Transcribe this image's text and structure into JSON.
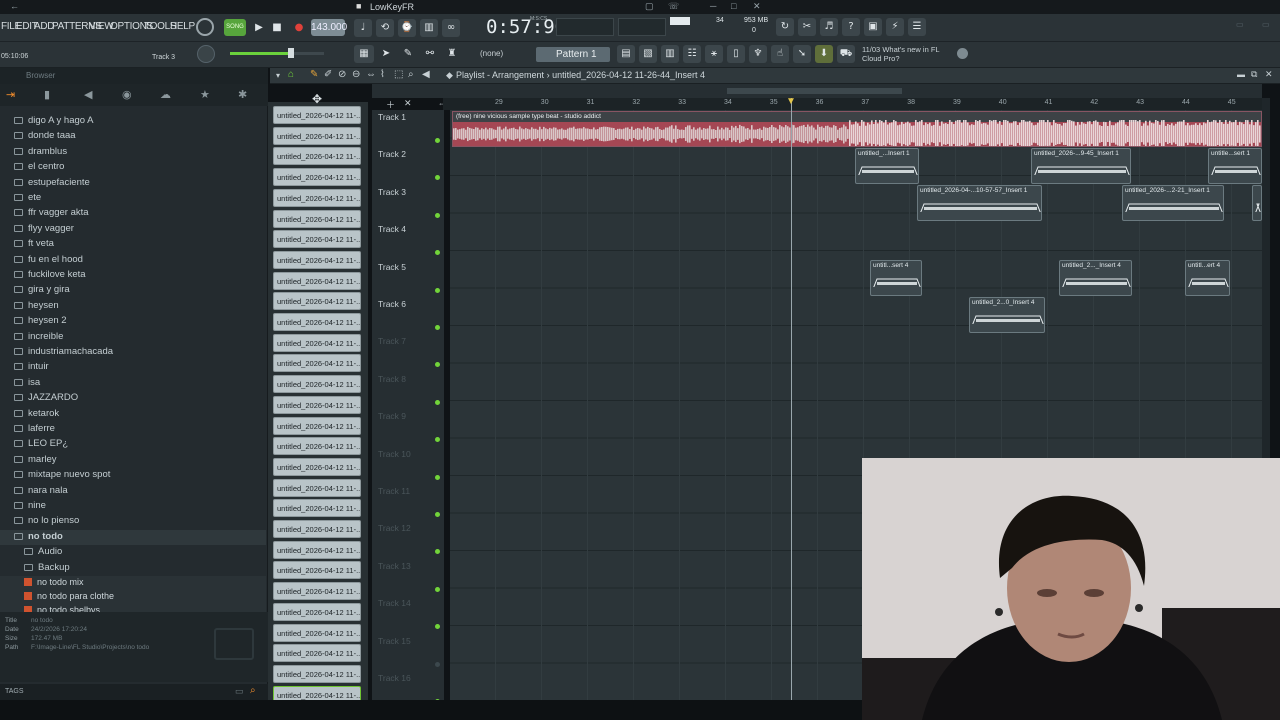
{
  "window": {
    "title": "LowKeyFR"
  },
  "menu": [
    "FILE",
    "EDIT",
    "ADD",
    "PATTERNS",
    "VIEW",
    "OPTIONS",
    "TOOLS",
    "HELP"
  ],
  "transport": {
    "mode": "SONG",
    "tempo": "143.000",
    "time": "0:57:90",
    "time_label": "M:S:CS",
    "cpu": "34",
    "memory": "953 MB",
    "voices": "0",
    "hint_time": "05:10:06",
    "hint_channel": "Track 3"
  },
  "pattern": {
    "selector": "(none)",
    "current": "Pattern 1"
  },
  "news": {
    "date": "11/03",
    "text": "What's new in FL Cloud Pro?"
  },
  "browser": {
    "title": "Browser",
    "folders": [
      "digo A y hago A",
      "donde taaa",
      "dramblus",
      "el centro",
      "estupefaciente",
      "ete",
      "ffr vagger akta",
      "flyy vagger",
      "ft veta",
      "fu en el hood",
      "fuckilove keta",
      "gira y gira",
      "heysen",
      "heysen 2",
      "increible",
      "industriamachacada",
      "intuir",
      "isa",
      "JAZZARDO",
      "ketarok",
      "laferre",
      "LEO EP¿",
      "marley",
      "mixtape nuevo spot",
      "nara nala",
      "nine",
      "no lo pienso",
      "no todo"
    ],
    "subfolders": [
      "Audio",
      "Backup"
    ],
    "files": [
      "no todo mix",
      "no todo para clothe",
      "no todo shelbys"
    ],
    "info": {
      "title_label": "Title",
      "title": "no todo",
      "date_label": "Date",
      "date": "24/2/2026 17:20:24",
      "size_label": "Size",
      "size": "172.47 MB",
      "path_label": "Path",
      "path": "F:\\Image-Line\\FL Studio\\Projects\\no todo"
    },
    "tags_label": "TAGS"
  },
  "channels": {
    "item": "untitled_2026-04-12 11-..."
  },
  "playlist": {
    "title": "Playlist - Arrangement",
    "project": "untitled_2026-04-12 11-26-44_Insert 4",
    "ruler": [
      "29",
      "30",
      "31",
      "32",
      "33",
      "34",
      "35",
      "36",
      "37",
      "38",
      "39",
      "40",
      "41",
      "42",
      "43",
      "44",
      "45"
    ],
    "tracks": [
      "Track 1",
      "Track 2",
      "Track 3",
      "Track 4",
      "Track 5",
      "Track 6",
      "Track 7",
      "Track 8",
      "Track 9",
      "Track 10",
      "Track 11",
      "Track 12",
      "Track 13",
      "Track 14",
      "Track 15",
      "Track 16"
    ],
    "audio_clip": "(free) nine vicious sample type beat - studio addict",
    "clips": {
      "t2a": "untitled_...Insert 1",
      "t2b": "untitled_2026-...9-45_Insert 1",
      "t2c": "untitle...sert 1",
      "t3a": "untitled_2026-04-...10-57-57_Insert 1",
      "t3b": "untitled_2026-...2-21_Insert 1",
      "t5a": "untitl...sert 4",
      "t5b": "untitled_2..._Insert 4",
      "t5c": "untitl...ert 4",
      "t6a": "untitled_2...0_Insert 4"
    }
  },
  "colors": {
    "accent": "#72d43a",
    "audio_clip": "#c84a5a",
    "background": "#2b3438"
  }
}
